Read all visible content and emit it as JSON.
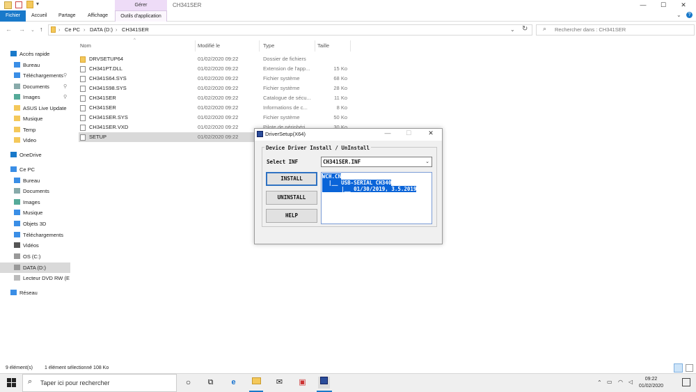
{
  "window": {
    "title": "CH341SER",
    "manage_label": "Gérer",
    "controls": {
      "minimize": "—",
      "maximize": "☐",
      "close": "✕"
    }
  },
  "ribbon": {
    "tabs": [
      "Fichier",
      "Accueil",
      "Partage",
      "Affichage",
      "Outils d'application"
    ],
    "accent": "#1979ca"
  },
  "address": {
    "crumbs": [
      "Ce PC",
      "DATA (D:)",
      "CH341SER"
    ],
    "search_placeholder": "Rechercher dans : CH341SER"
  },
  "nav": {
    "items": [
      {
        "label": "Accès rapide",
        "icon": "star-icon",
        "indent": 0,
        "top": 0
      },
      {
        "label": "Bureau",
        "icon": "desktop-icon",
        "indent": 1
      },
      {
        "label": "Téléchargements",
        "icon": "download-icon",
        "indent": 1
      },
      {
        "label": "Documents",
        "icon": "document-icon",
        "indent": 1
      },
      {
        "label": "Images",
        "icon": "image-icon",
        "indent": 1
      },
      {
        "label": "ASUS Live Update",
        "icon": "folder-icon",
        "indent": 1
      },
      {
        "label": "Musique",
        "icon": "folder-icon",
        "indent": 1
      },
      {
        "label": "Temp",
        "icon": "folder-icon",
        "indent": 1
      },
      {
        "label": "Video",
        "icon": "folder-icon",
        "indent": 1
      },
      {
        "label": "OneDrive",
        "icon": "cloud-icon",
        "indent": 0
      },
      {
        "label": "Ce PC",
        "icon": "computer-icon",
        "indent": 0
      },
      {
        "label": "Bureau",
        "icon": "desktop-icon",
        "indent": 1
      },
      {
        "label": "Documents",
        "icon": "document-icon",
        "indent": 1
      },
      {
        "label": "Images",
        "icon": "image-icon",
        "indent": 1
      },
      {
        "label": "Musique",
        "icon": "music-icon",
        "indent": 1
      },
      {
        "label": "Objets 3D",
        "icon": "cube-icon",
        "indent": 1
      },
      {
        "label": "Téléchargements",
        "icon": "download-icon",
        "indent": 1
      },
      {
        "label": "Vidéos",
        "icon": "video-icon",
        "indent": 1
      },
      {
        "label": "OS (C:)",
        "icon": "drive-icon",
        "indent": 1
      },
      {
        "label": "DATA (D:)",
        "icon": "drive-icon",
        "indent": 1,
        "selected": true
      },
      {
        "label": "Lecteur DVD RW (E",
        "icon": "dvd-icon",
        "indent": 1
      },
      {
        "label": "Réseau",
        "icon": "network-icon",
        "indent": 0
      }
    ]
  },
  "files": {
    "columns": [
      "Nom",
      "Modifié le",
      "Type",
      "Taille"
    ],
    "rows": [
      {
        "name": "DRVSETUP64",
        "date": "01/02/2020 09:22",
        "type": "Dossier de fichiers",
        "size": "",
        "folder": true
      },
      {
        "name": "CH341PT.DLL",
        "date": "01/02/2020 09:22",
        "type": "Extension de l'app...",
        "size": "15 Ko"
      },
      {
        "name": "CH341S64.SYS",
        "date": "01/02/2020 09:22",
        "type": "Fichier système",
        "size": "68 Ko"
      },
      {
        "name": "CH341S98.SYS",
        "date": "01/02/2020 09:22",
        "type": "Fichier système",
        "size": "28 Ko"
      },
      {
        "name": "CH341SER",
        "date": "01/02/2020 09:22",
        "type": "Catalogue de sécu...",
        "size": "11 Ko"
      },
      {
        "name": "CH341SER",
        "date": "01/02/2020 09:22",
        "type": "Informations de c...",
        "size": "8 Ko"
      },
      {
        "name": "CH341SER.SYS",
        "date": "01/02/2020 09:22",
        "type": "Fichier système",
        "size": "50 Ko"
      },
      {
        "name": "CH341SER.VXD",
        "date": "01/02/2020 09:22",
        "type": "Pilote de périphéri...",
        "size": "30 Ko"
      },
      {
        "name": "SETUP",
        "date": "01/02/2020 09:22",
        "type": "",
        "size": "",
        "selected": true
      }
    ]
  },
  "status": {
    "count": "9 élément(s)",
    "selection": "1 élément sélectionné  108 Ko"
  },
  "dialog": {
    "title": "DriverSetup(X64)",
    "group_label": "Device Driver Install / UnInstall",
    "select_label": "Select INF",
    "select_value": "CH341SER.INF",
    "buttons": {
      "install": "INSTALL",
      "uninstall": "UNINSTALL",
      "help": "HELP"
    },
    "info_lines": [
      "WCH.CN",
      "  |__ USB-SERIAL CH340",
      "      |__ 01/30/2019, 3.5.2019"
    ]
  },
  "taskbar": {
    "search_placeholder": "Taper ici pour rechercher",
    "time": "09:22",
    "date": "01/02/2020"
  }
}
